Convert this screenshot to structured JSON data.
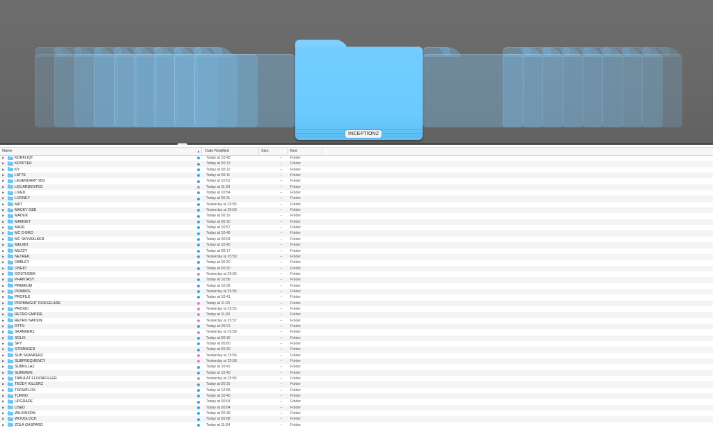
{
  "colors": {
    "tag_blue": "#3aa2e3",
    "tag_pink": "#e57fc8",
    "folder_blue": "#6ccaff"
  },
  "coverflow": {
    "selected_label": "INCEPTIONZ",
    "icon": "folder-icon"
  },
  "columns": {
    "name": "Name",
    "sort_indicator": "▲",
    "date_modified": "Date Modified",
    "size": "Size",
    "kind": "Kind"
  },
  "rows": [
    {
      "name": "KONFLIQT",
      "tag": "blue",
      "date": "Today at 10:42",
      "size": "--",
      "kind": "Folder"
    },
    {
      "name": "KRYPTEK",
      "tag": "blue",
      "date": "Today at 00:13",
      "size": "--",
      "kind": "Folder"
    },
    {
      "name": "KY",
      "tag": "blue",
      "date": "Today at 00:12",
      "size": "--",
      "kind": "Folder"
    },
    {
      "name": "LATTE",
      "tag": "blue",
      "date": "Today at 00:11",
      "size": "--",
      "kind": "Folder"
    },
    {
      "name": "LEGENDARY 90S",
      "tag": "blue",
      "date": "Today at 10:53",
      "size": "--",
      "kind": "Folder"
    },
    {
      "name": "LES ARDENTES",
      "tag": "pink",
      "date": "Today at 11:03",
      "size": "--",
      "kind": "Folder"
    },
    {
      "name": "LIXED",
      "tag": "blue",
      "date": "Today at 10:54",
      "size": "--",
      "kind": "Folder"
    },
    {
      "name": "LOONEY",
      "tag": "blue",
      "date": "Today at 00:11",
      "size": "--",
      "kind": "Folder"
    },
    {
      "name": "M&T",
      "tag": "blue",
      "date": "Yesterday at 23:55",
      "size": "--",
      "kind": "Folder"
    },
    {
      "name": "MACKY GEE",
      "tag": "blue",
      "date": "Yesterday at 23:59",
      "size": "--",
      "kind": "Folder"
    },
    {
      "name": "MADUK",
      "tag": "blue",
      "date": "Today at 00:19",
      "size": "--",
      "kind": "Folder"
    },
    {
      "name": "MAMDET",
      "tag": "blue",
      "date": "Today at 00:15",
      "size": "--",
      "kind": "Folder"
    },
    {
      "name": "MAZE",
      "tag": "blue",
      "date": "Today at 10:57",
      "size": "--",
      "kind": "Folder"
    },
    {
      "name": "MC D-BRO",
      "tag": "blue",
      "date": "Today at 10:46",
      "size": "--",
      "kind": "Folder"
    },
    {
      "name": "MC SKYWALKER",
      "tag": "blue",
      "date": "Today at 00:04",
      "size": "--",
      "kind": "Folder"
    },
    {
      "name": "MELMO",
      "tag": "blue",
      "date": "Today at 10:42",
      "size": "--",
      "kind": "Folder"
    },
    {
      "name": "MUZZY",
      "tag": "blue",
      "date": "Today at 00:17",
      "size": "--",
      "kind": "Folder"
    },
    {
      "name": "NETREK",
      "tag": "blue",
      "date": "Yesterday at 23:59",
      "size": "--",
      "kind": "Folder"
    },
    {
      "name": "OBBLEY",
      "tag": "blue",
      "date": "Today at 00:20",
      "size": "--",
      "kind": "Folder"
    },
    {
      "name": "ONE87",
      "tag": "blue",
      "date": "Today at 00:20",
      "size": "--",
      "kind": "Folder"
    },
    {
      "name": "OOSTHOEK",
      "tag": "pink",
      "date": "Yesterday at 23:55",
      "size": "--",
      "kind": "Folder"
    },
    {
      "name": "PHANTASY",
      "tag": "blue",
      "date": "Today at 10:58",
      "size": "--",
      "kind": "Folder"
    },
    {
      "name": "PREMIUM",
      "tag": "blue",
      "date": "Today at 10:39",
      "size": "--",
      "kind": "Folder"
    },
    {
      "name": "PRIMATE",
      "tag": "blue",
      "date": "Yesterday at 23:55",
      "size": "--",
      "kind": "Folder"
    },
    {
      "name": "PROFILE",
      "tag": "blue",
      "date": "Today at 10:41",
      "size": "--",
      "kind": "Folder"
    },
    {
      "name": "PROMNIGHT ROESELARE",
      "tag": "pink",
      "date": "Today at 11:02",
      "size": "--",
      "kind": "Folder"
    },
    {
      "name": "PROXIC",
      "tag": "pink",
      "date": "Yesterday at 23:55",
      "size": "--",
      "kind": "Folder"
    },
    {
      "name": "RETRO EMPIRE",
      "tag": "pink",
      "date": "Today at 11:00",
      "size": "--",
      "kind": "Folder"
    },
    {
      "name": "RETRO NATION",
      "tag": "pink",
      "date": "Yesterday at 23:57",
      "size": "--",
      "kind": "Folder"
    },
    {
      "name": "RTTN",
      "tag": "blue",
      "date": "Today at 00:21",
      "size": "--",
      "kind": "Folder"
    },
    {
      "name": "SKANKERZ",
      "tag": "pink",
      "date": "Yesterday at 23:58",
      "size": "--",
      "kind": "Folder"
    },
    {
      "name": "SOLIX",
      "tag": "blue",
      "date": "Today at 00:16",
      "size": "--",
      "kind": "Folder"
    },
    {
      "name": "SPY",
      "tag": "blue",
      "date": "Today at 00:00",
      "size": "--",
      "kind": "Folder"
    },
    {
      "name": "STRANGER",
      "tag": "blue",
      "date": "Today at 00:19",
      "size": "--",
      "kind": "Folder"
    },
    {
      "name": "SUB SKANKERZ",
      "tag": "pink",
      "date": "Yesterday at 23:56",
      "size": "--",
      "kind": "Folder"
    },
    {
      "name": "SUBFREQUENCY",
      "tag": "pink",
      "date": "Yesterday at 23:58",
      "size": "--",
      "kind": "Folder"
    },
    {
      "name": "SUBKILLAZ",
      "tag": "blue",
      "date": "Today at 10:41",
      "size": "--",
      "kind": "Folder"
    },
    {
      "name": "SUBWAVE",
      "tag": "blue",
      "date": "Today at 10:42",
      "size": "--",
      "kind": "Folder"
    },
    {
      "name": "TABULAT FLOORFILLER",
      "tag": "pink",
      "date": "Yesterday at 23:56",
      "size": "--",
      "kind": "Folder"
    },
    {
      "name": "TEDDY KILLERZ",
      "tag": "blue",
      "date": "Today at 00:16",
      "size": "--",
      "kind": "Folder"
    },
    {
      "name": "TROWFLOX",
      "tag": "blue",
      "date": "Today at 12:58",
      "size": "--",
      "kind": "Folder"
    },
    {
      "name": "TURNO",
      "tag": "blue",
      "date": "Today at 10:40",
      "size": "--",
      "kind": "Folder"
    },
    {
      "name": "UPGRADE",
      "tag": "blue",
      "date": "Today at 00:04",
      "size": "--",
      "kind": "Folder"
    },
    {
      "name": "USED",
      "tag": "blue",
      "date": "Today at 00:04",
      "size": "--",
      "kind": "Folder"
    },
    {
      "name": "WILKINSON",
      "tag": "blue",
      "date": "Today at 00:18",
      "size": "--",
      "kind": "Folder"
    },
    {
      "name": "WOODLOCK",
      "tag": "blue",
      "date": "Today at 00:08",
      "size": "--",
      "kind": "Folder"
    },
    {
      "name": "ZOLA GASPARO",
      "tag": "blue",
      "date": "Today at 11:04",
      "size": "--",
      "kind": "Folder"
    }
  ]
}
